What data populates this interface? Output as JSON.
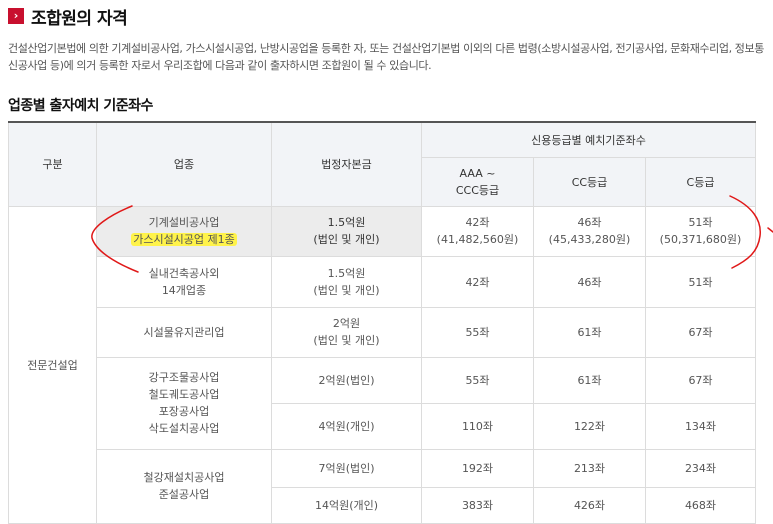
{
  "page": {
    "title_icon": "chevron-right-icon",
    "title": "조합원의 자격",
    "description": "건설산업기본법에 의한 기계설비공사업, 가스시설시공업, 난방시공업을 등록한 자, 또는 건설산업기본법 이외의 다른 법령(소방시설공사업, 전기공사업, 문화재수리업, 정보통신공사업 등)에 의거 등록한 자로서 우리조합에 다음과 같이 출자하시면 조합원이 될 수 있습니다.",
    "subtitle": "업종별 출자예치 기준좌수"
  },
  "table": {
    "headers": {
      "category": "구분",
      "industry": "업종",
      "capital": "법정자본금",
      "credit_group": "신용등급별 예치기준좌수",
      "grade_aaa_line1": "AAA ~",
      "grade_aaa_line2": "CCC등급",
      "grade_cc": "CC등급",
      "grade_c": "C등급"
    },
    "category_label": "전문건설업",
    "rows": [
      {
        "industry_line1": "기계설비공사업",
        "industry_line2": "가스시설시공업 제1종",
        "capital_line1": "1.5억원",
        "capital_line2": "(법인 및 개인)",
        "aaa": "42좌",
        "aaa_amount": "(41,482,560원)",
        "cc": "46좌",
        "cc_amount": "(45,433,280원)",
        "c": "51좌",
        "c_amount": "(50,371,680원)"
      },
      {
        "industry_line1": "실내건축공사외",
        "industry_line2": "14개업종",
        "capital_line1": "1.5억원",
        "capital_line2": "(법인 및 개인)",
        "aaa": "42좌",
        "cc": "46좌",
        "c": "51좌"
      },
      {
        "industry_line1": "시설물유지관리업",
        "capital_line1": "2억원",
        "capital_line2": "(법인 및 개인)",
        "aaa": "55좌",
        "cc": "61좌",
        "c": "67좌"
      },
      {
        "industry_line1": "강구조물공사업",
        "industry_line2": "철도궤도공사업",
        "industry_line3": "포장공사업",
        "industry_line4": "삭도설치공사업",
        "sub": [
          {
            "capital": "2억원(법인)",
            "aaa": "55좌",
            "cc": "61좌",
            "c": "67좌"
          },
          {
            "capital": "4억원(개인)",
            "aaa": "110좌",
            "cc": "122좌",
            "c": "134좌"
          }
        ]
      },
      {
        "industry_line1": "철강재설치공사업",
        "industry_line2": "준설공사업",
        "sub": [
          {
            "capital": "7억원(법인)",
            "aaa": "192좌",
            "cc": "213좌",
            "c": "234좌"
          },
          {
            "capital": "14억원(개인)",
            "aaa": "383좌",
            "cc": "426좌",
            "c": "468좌"
          }
        ]
      }
    ]
  },
  "annotation_color": "#e01818",
  "highlight_color": "#fff34a"
}
